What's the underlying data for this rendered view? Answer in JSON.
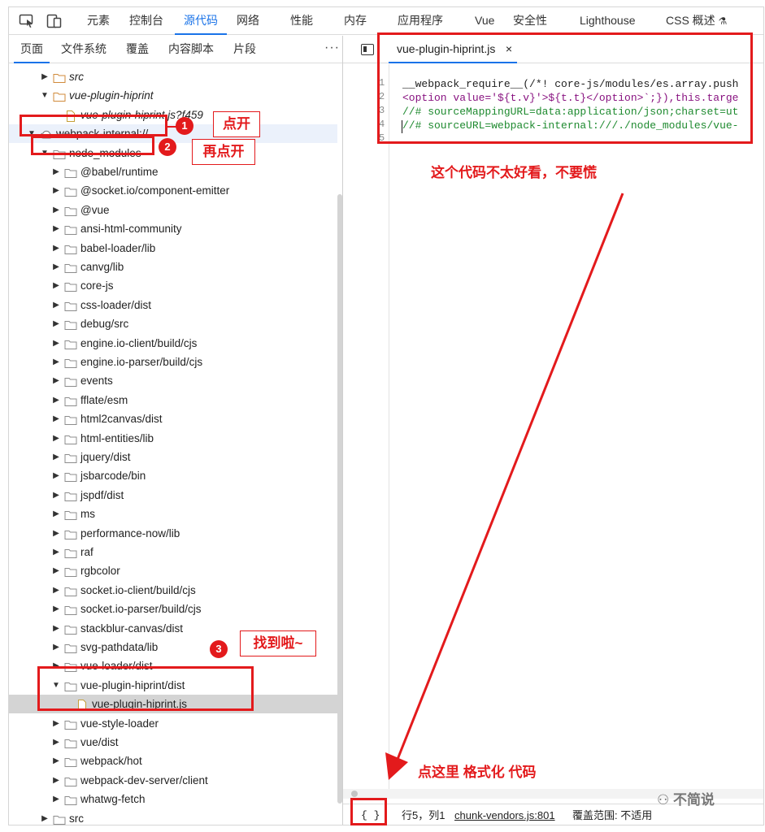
{
  "top_tabs": [
    "元素",
    "控制台",
    "源代码",
    "网络",
    "性能",
    "内存",
    "应用程序",
    "Vue",
    "安全性",
    "Lighthouse",
    "CSS 概述"
  ],
  "sub_tabs": [
    "页面",
    "文件系统",
    "覆盖",
    "内容脚本",
    "片段"
  ],
  "more_label": "⋮",
  "tree": [
    {
      "label": "src",
      "italic": true,
      "expanded": false,
      "type": "folder"
    },
    {
      "label": "vue-plugin-hiprint",
      "italic": true,
      "expanded": true,
      "type": "folder"
    },
    {
      "label": "vue-plugin-hiprint.js?f459",
      "italic": true,
      "type": "file"
    },
    {
      "label": "webpack-internal://",
      "expanded": true,
      "type": "cloud"
    },
    {
      "label": "node_modules",
      "expanded": true,
      "type": "folder"
    },
    {
      "label": "@babel/runtime",
      "type": "folder"
    },
    {
      "label": "@socket.io/component-emitter",
      "type": "folder"
    },
    {
      "label": "@vue",
      "type": "folder"
    },
    {
      "label": "ansi-html-community",
      "type": "folder"
    },
    {
      "label": "babel-loader/lib",
      "type": "folder"
    },
    {
      "label": "canvg/lib",
      "type": "folder"
    },
    {
      "label": "core-js",
      "type": "folder"
    },
    {
      "label": "css-loader/dist",
      "type": "folder"
    },
    {
      "label": "debug/src",
      "type": "folder"
    },
    {
      "label": "engine.io-client/build/cjs",
      "type": "folder"
    },
    {
      "label": "engine.io-parser/build/cjs",
      "type": "folder"
    },
    {
      "label": "events",
      "type": "folder"
    },
    {
      "label": "fflate/esm",
      "type": "folder"
    },
    {
      "label": "html2canvas/dist",
      "type": "folder"
    },
    {
      "label": "html-entities/lib",
      "type": "folder"
    },
    {
      "label": "jquery/dist",
      "type": "folder"
    },
    {
      "label": "jsbarcode/bin",
      "type": "folder"
    },
    {
      "label": "jspdf/dist",
      "type": "folder"
    },
    {
      "label": "ms",
      "type": "folder"
    },
    {
      "label": "performance-now/lib",
      "type": "folder"
    },
    {
      "label": "raf",
      "type": "folder"
    },
    {
      "label": "rgbcolor",
      "type": "folder"
    },
    {
      "label": "socket.io-client/build/cjs",
      "type": "folder"
    },
    {
      "label": "socket.io-parser/build/cjs",
      "type": "folder"
    },
    {
      "label": "stackblur-canvas/dist",
      "type": "folder"
    },
    {
      "label": "svg-pathdata/lib",
      "type": "folder"
    },
    {
      "label": "vue-loader/dist",
      "type": "folder"
    },
    {
      "label": "vue-plugin-hiprint/dist",
      "expanded": true,
      "type": "folder"
    },
    {
      "label": "vue-plugin-hiprint.js",
      "type": "file"
    },
    {
      "label": "vue-style-loader",
      "type": "folder"
    },
    {
      "label": "vue/dist",
      "type": "folder"
    },
    {
      "label": "webpack/hot",
      "type": "folder"
    },
    {
      "label": "webpack-dev-server/client",
      "type": "folder"
    },
    {
      "label": "whatwg-fetch",
      "type": "folder"
    },
    {
      "label": "src",
      "type": "folder"
    }
  ],
  "editor": {
    "tab_label": "vue-plugin-hiprint.js",
    "close_label": "×",
    "line_numbers": [
      "1",
      "2",
      "3",
      "4",
      "5"
    ],
    "lines": [
      "__webpack_require__(/*! core-js/modules/es.array.push",
      "<option value='${t.v}'>${t.t}</option>`;}),this.targe",
      "//# sourceMappingURL=data:application/json;charset=ut",
      "//# sourceURL=webpack-internal:///./node_modules/vue-",
      ""
    ]
  },
  "status": {
    "format_button": "{ }",
    "position": "行5，列1",
    "source_link": "chunk-vendors.js:801",
    "coverage": "覆盖范围: 不适用"
  },
  "annotations": {
    "step1_badge": "1",
    "step1_text": "点开",
    "step2_badge": "2",
    "step2_text": "再点开",
    "step3_badge": "3",
    "step3_text": "找到啦~",
    "code_note": "这个代码不太好看，不要慌",
    "format_note": "点这里 格式化 代码"
  },
  "watermark": "不简说"
}
